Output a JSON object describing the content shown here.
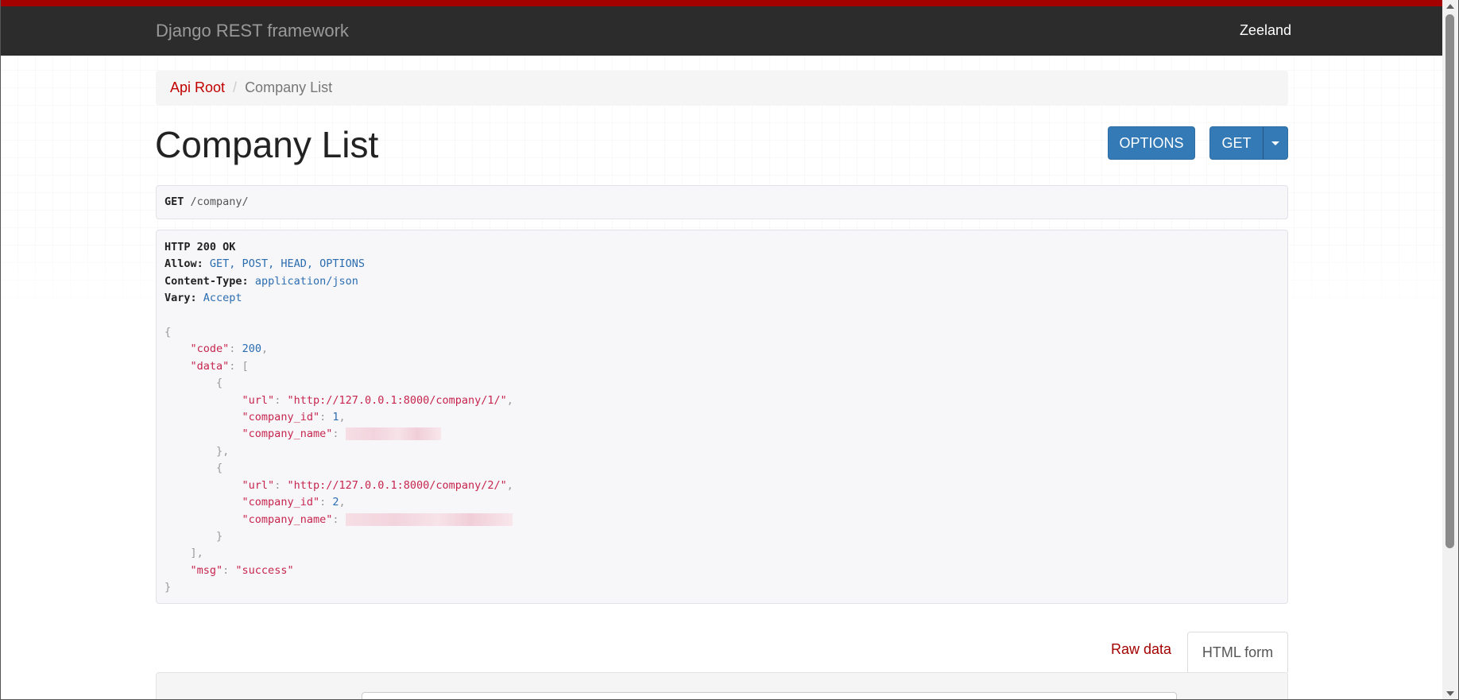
{
  "navbar": {
    "brand": "Django REST framework",
    "user": "Zeeland"
  },
  "breadcrumb": {
    "root": "Api Root",
    "separator": "/",
    "current": "Company List"
  },
  "page": {
    "title": "Company List"
  },
  "buttons": {
    "options": "OPTIONS",
    "get": "GET"
  },
  "request": {
    "method": "GET",
    "path": "/company/"
  },
  "response": {
    "status": "HTTP 200 OK",
    "headers": [
      {
        "name": "Allow:",
        "value": "GET, POST, HEAD, OPTIONS"
      },
      {
        "name": "Content-Type:",
        "value": "application/json"
      },
      {
        "name": "Vary:",
        "value": "Accept"
      }
    ],
    "body": {
      "code_key": "\"code\"",
      "code_value": "200",
      "data_key": "\"data\"",
      "items": [
        {
          "url_key": "\"url\"",
          "url_value": "\"http://127.0.0.1:8000/company/1/\"",
          "id_key": "\"company_id\"",
          "id_value": "1",
          "name_key": "\"company_name\""
        },
        {
          "url_key": "\"url\"",
          "url_value": "\"http://127.0.0.1:8000/company/2/\"",
          "id_key": "\"company_id\"",
          "id_value": "2",
          "name_key": "\"company_name\""
        }
      ],
      "msg_key": "\"msg\"",
      "msg_value": "\"success\""
    }
  },
  "tabs": {
    "raw": "Raw data",
    "html": "HTML form"
  },
  "colors": {
    "navbar_bg": "#2c2c2c",
    "navbar_accent": "#a30000",
    "link": "#c20000",
    "button": "#337ab7",
    "string": "#c7254e",
    "number": "#2b6db0"
  }
}
